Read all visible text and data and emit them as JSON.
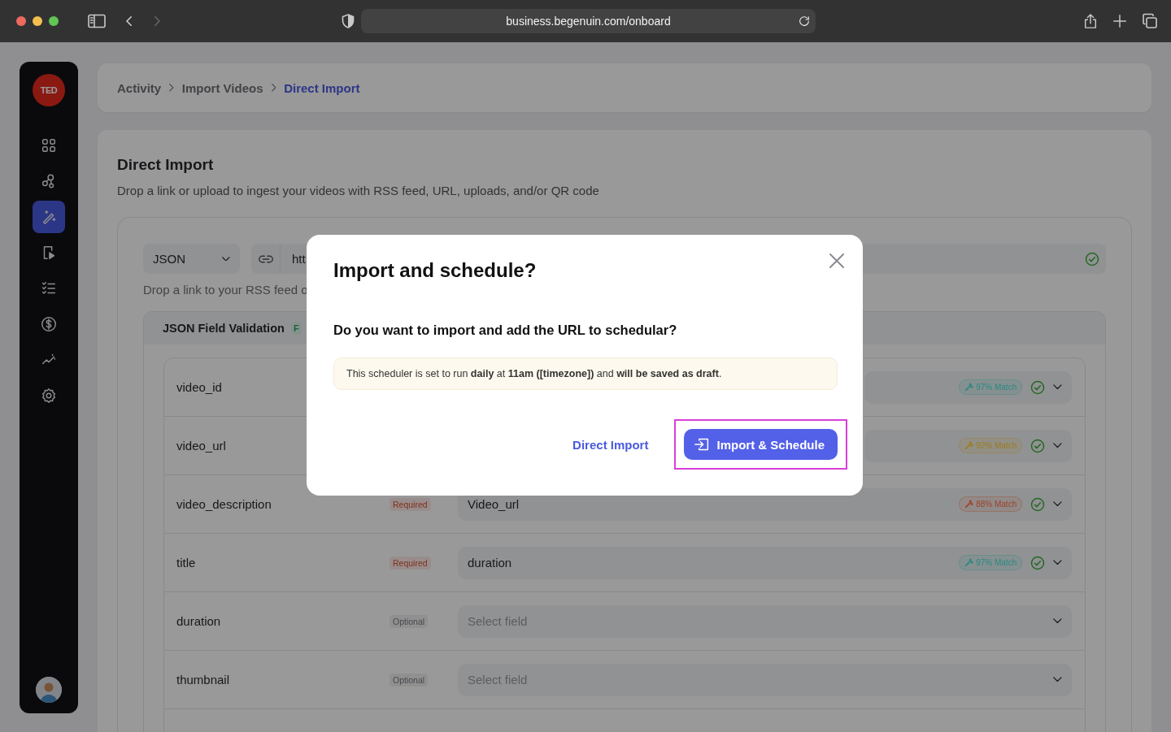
{
  "browser": {
    "url": "business.begenuin.com/onboard",
    "back_enabled": true,
    "forward_enabled": false
  },
  "sidebar": {
    "logo": "TED",
    "items": [
      {
        "kind": "grid",
        "selected": false
      },
      {
        "kind": "nodes",
        "selected": false
      },
      {
        "kind": "wand",
        "selected": true
      },
      {
        "kind": "video",
        "selected": false
      },
      {
        "kind": "checklist",
        "selected": false
      },
      {
        "kind": "dollar",
        "selected": false
      },
      {
        "kind": "chart",
        "selected": false
      },
      {
        "kind": "gear",
        "selected": false
      }
    ]
  },
  "breadcrumb": [
    {
      "label": "Activity",
      "current": false
    },
    {
      "label": "Import Videos",
      "current": false
    },
    {
      "label": "Direct Import",
      "current": true
    }
  ],
  "page": {
    "title": "Direct Import",
    "subtitle": "Drop a link or upload to ingest your videos with RSS feed, URL, uploads, and/or QR code"
  },
  "source": {
    "format": "JSON",
    "url_value": "htt",
    "verified": true,
    "hint": "Drop a link to your RSS feed o"
  },
  "validation": {
    "title": "JSON Field Validation",
    "badge": "F",
    "rows": [
      {
        "name": "video_id",
        "match": {
          "label": "97% Match",
          "color": "#2a8a80"
        },
        "verified": true
      },
      {
        "name": "video_url",
        "match": {
          "label": "92% Match",
          "color": "#a07c1c"
        },
        "verified": true
      },
      {
        "name": "video_description",
        "tag": {
          "label": "Required",
          "kind": "required"
        },
        "value": "Video_url",
        "match": {
          "label": "88% Match",
          "color": "#a0442c"
        },
        "verified": true
      },
      {
        "name": "title",
        "tag": {
          "label": "Required",
          "kind": "required"
        },
        "value": "duration",
        "match": {
          "label": "97% Match",
          "color": "#2a8a80"
        },
        "verified": true
      },
      {
        "name": "duration",
        "tag": {
          "label": "Optional",
          "kind": "optional"
        },
        "placeholder": "Select field",
        "verified": false
      },
      {
        "name": "thumbnail",
        "tag": {
          "label": "Optional",
          "kind": "optional"
        },
        "placeholder": "Select field",
        "verified": false
      }
    ]
  },
  "dialog": {
    "title": "Import and schedule?",
    "question": "Do you want to import and add the URL to schedular?",
    "notice": "This scheduler is set to run **daily** at **11am ([timezone])** and **will be saved as draft**.",
    "secondary": "Direct Import",
    "primary": {
      "label": "Import & Schedule",
      "highlighted": true
    }
  }
}
